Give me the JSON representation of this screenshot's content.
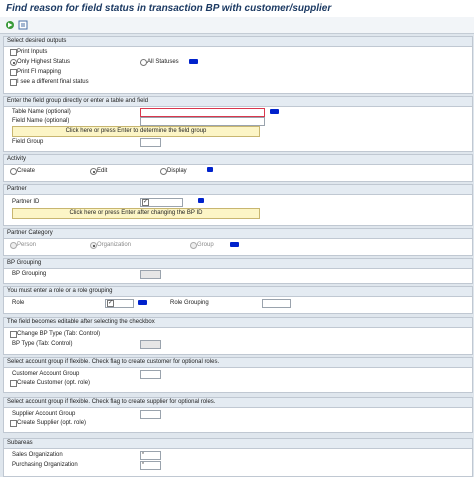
{
  "window": {
    "title": "Find reason for field status in transaction BP with customer/supplier"
  },
  "toolbar": {
    "execute_icon": "execute-icon",
    "variant_icon": "get-variant-icon"
  },
  "sections": {
    "outputs": {
      "title": "Select desired outputs",
      "print_inputs": "Print Inputs",
      "only_highest": "Only Highest Status",
      "all_statuses": "All Statuses",
      "print_fi": "Print FI mapping",
      "different_final": "I see a different final status"
    },
    "field_group": {
      "title": "Enter the field group directly or enter a table and field",
      "table_name": "Table Name (optional)",
      "field_name": "Field Name (optional)",
      "determine_btn": "Click here or press Enter to determine the field group",
      "field_group": "Field Group"
    },
    "activity": {
      "title": "Activity",
      "create": "Create",
      "edit": "Edit",
      "display": "Display"
    },
    "partner": {
      "title": "Partner",
      "partner_id": "Partner ID",
      "change_btn": "Click here or press Enter after changing the BP ID"
    },
    "partner_category": {
      "title": "Partner Category",
      "person": "Person",
      "organization": "Organization",
      "group": "Group"
    },
    "bp_grouping": {
      "title": "BP Grouping",
      "bp_grouping": "BP Grouping"
    },
    "role": {
      "title": "You must enter a role or a role grouping",
      "role": "Role",
      "role_grouping": "Role Grouping"
    },
    "editable": {
      "title": "The field becomes editable after selecting the checkbox",
      "change_bp_type": "Change BP Type (Tab: Control)",
      "bp_type": "BP Type (Tab: Control)"
    },
    "customer": {
      "title": "Select account group if flexible. Check flag to create customer for optional roles.",
      "account_group": "Customer Account Group",
      "create": "Create Customer (opt. role)"
    },
    "supplier": {
      "title": "Select account group if flexible. Check flag to create supplier for optional roles.",
      "account_group": "Supplier Account Group",
      "create": "Create Supplier (opt. role)"
    },
    "subareas": {
      "title": "Subareas",
      "sales_org": "Sales Organization",
      "purchasing_org": "Purchasing Organization",
      "sales_value": "*",
      "purchasing_value": "*"
    }
  },
  "colors": {
    "accent": "#1c3a63",
    "button": "#fcf5c6",
    "redaction": "#0022cc",
    "required_border": "#d9374d"
  }
}
